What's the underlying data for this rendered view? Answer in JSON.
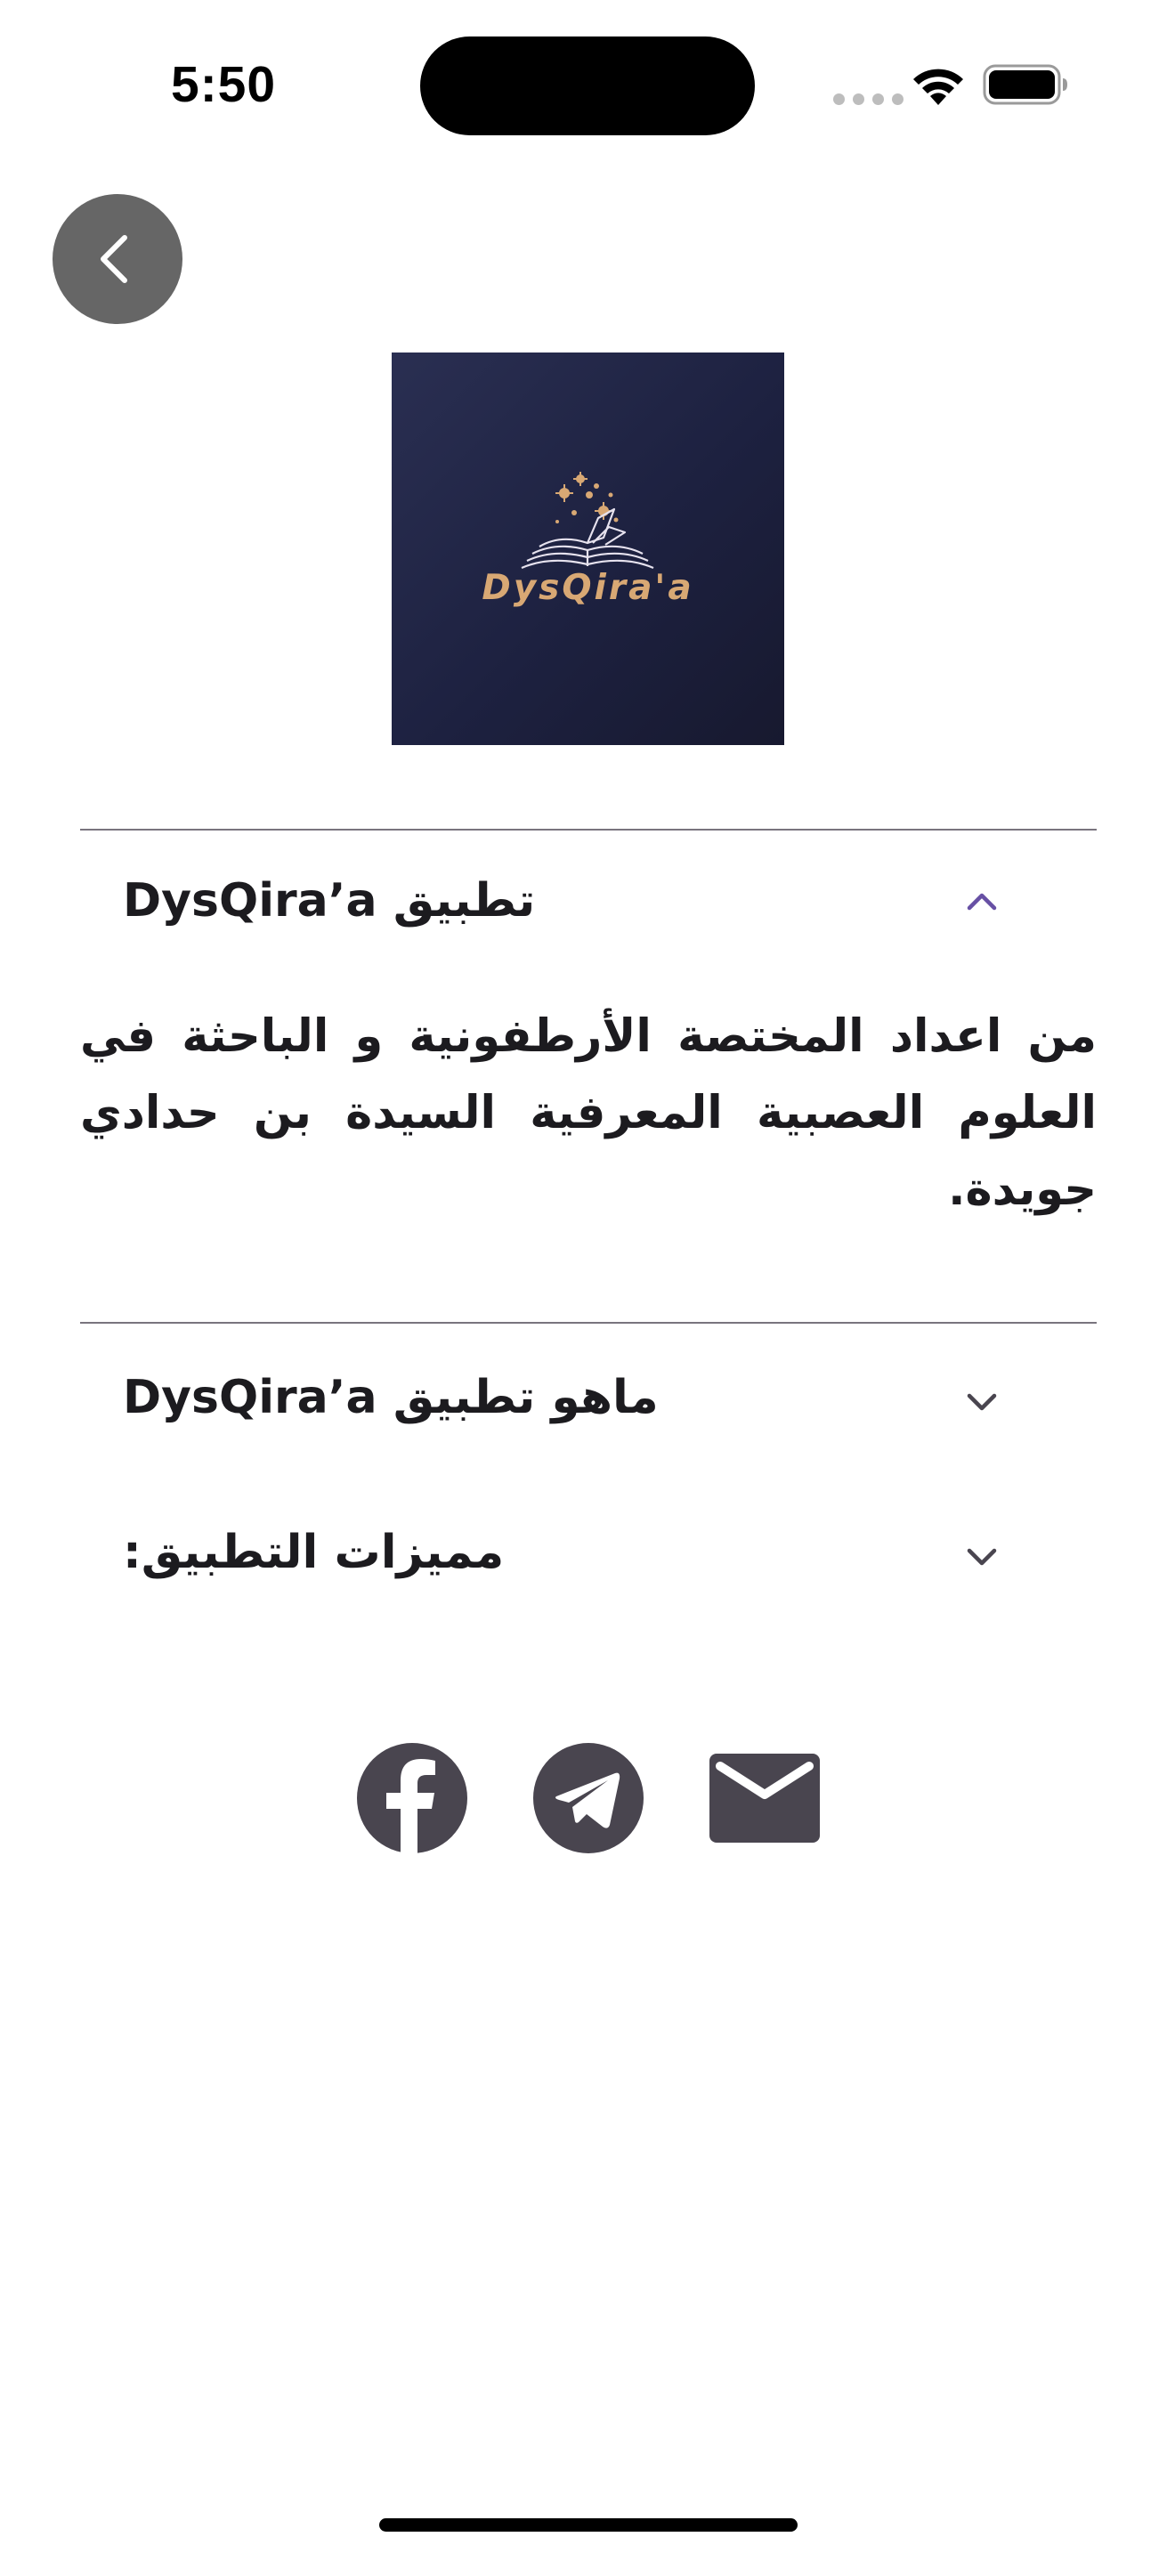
{
  "status_bar": {
    "time": "5:50"
  },
  "navigation": {
    "back_icon": "chevron-left-icon"
  },
  "logo": {
    "text": "DysQira'a",
    "background_color": "#1f2342",
    "text_color": "#d8a874",
    "icon": "open-book-sparkles-icon"
  },
  "accordion": {
    "sections": [
      {
        "title": "تطبيق DysQira’a",
        "expanded": true,
        "body": "من اعداد المختصة الأرطفونية و الباحثة في العلوم العصبية المعرفية السيدة بن حدادي جويدة."
      },
      {
        "title": "ماهو تطبيق DysQira’a",
        "expanded": false
      },
      {
        "title": "مميزات التطبيق:",
        "expanded": false
      }
    ],
    "chevron_color_expanded": "#6750a4",
    "chevron_color_collapsed": "#49454f"
  },
  "social": {
    "icon_color": "#49454f",
    "items": [
      {
        "name": "facebook",
        "icon": "facebook-icon"
      },
      {
        "name": "telegram",
        "icon": "telegram-icon"
      },
      {
        "name": "email",
        "icon": "mail-icon"
      }
    ]
  }
}
